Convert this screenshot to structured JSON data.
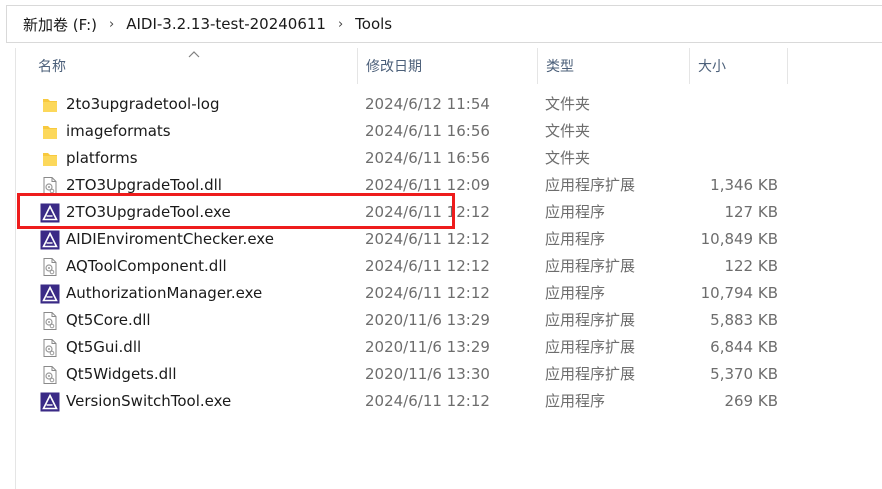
{
  "breadcrumb": {
    "items": [
      "新加卷 (F:)",
      "AIDI-3.2.13-test-20240611",
      "Tools"
    ],
    "separator": "›"
  },
  "columns": {
    "name": "名称",
    "date": "修改日期",
    "type": "类型",
    "size": "大小"
  },
  "files": [
    {
      "name": "2to3upgradetool-log",
      "date": "2024/6/12 11:54",
      "type": "文件夹",
      "size": "",
      "icon": "folder-icon"
    },
    {
      "name": "imageformats",
      "date": "2024/6/11 16:56",
      "type": "文件夹",
      "size": "",
      "icon": "folder-icon"
    },
    {
      "name": "platforms",
      "date": "2024/6/11 16:56",
      "type": "文件夹",
      "size": "",
      "icon": "folder-icon"
    },
    {
      "name": "2TO3UpgradeTool.dll",
      "date": "2024/6/11 12:09",
      "type": "应用程序扩展",
      "size": "1,346 KB",
      "icon": "dll-icon"
    },
    {
      "name": "2TO3UpgradeTool.exe",
      "date": "2024/6/11 12:12",
      "type": "应用程序",
      "size": "127 KB",
      "icon": "aidi-app-icon"
    },
    {
      "name": "AIDIEnviromentChecker.exe",
      "date": "2024/6/11 12:12",
      "type": "应用程序",
      "size": "10,849 KB",
      "icon": "aidi-app-icon"
    },
    {
      "name": "AQToolComponent.dll",
      "date": "2024/6/11 12:12",
      "type": "应用程序扩展",
      "size": "122 KB",
      "icon": "dll-icon"
    },
    {
      "name": "AuthorizationManager.exe",
      "date": "2024/6/11 12:12",
      "type": "应用程序",
      "size": "10,794 KB",
      "icon": "aidi-app-icon"
    },
    {
      "name": "Qt5Core.dll",
      "date": "2020/11/6 13:29",
      "type": "应用程序扩展",
      "size": "5,883 KB",
      "icon": "dll-icon"
    },
    {
      "name": "Qt5Gui.dll",
      "date": "2020/11/6 13:29",
      "type": "应用程序扩展",
      "size": "6,844 KB",
      "icon": "dll-icon"
    },
    {
      "name": "Qt5Widgets.dll",
      "date": "2020/11/6 13:30",
      "type": "应用程序扩展",
      "size": "5,370 KB",
      "icon": "dll-icon"
    },
    {
      "name": "VersionSwitchTool.exe",
      "date": "2024/6/11 12:12",
      "type": "应用程序",
      "size": "269 KB",
      "icon": "aidi-app-icon"
    }
  ],
  "colors": {
    "highlight_box": "#ee1c1c",
    "folder": "#f8c93e",
    "app_icon": "#3a2a86",
    "header_text": "#4c607a"
  }
}
